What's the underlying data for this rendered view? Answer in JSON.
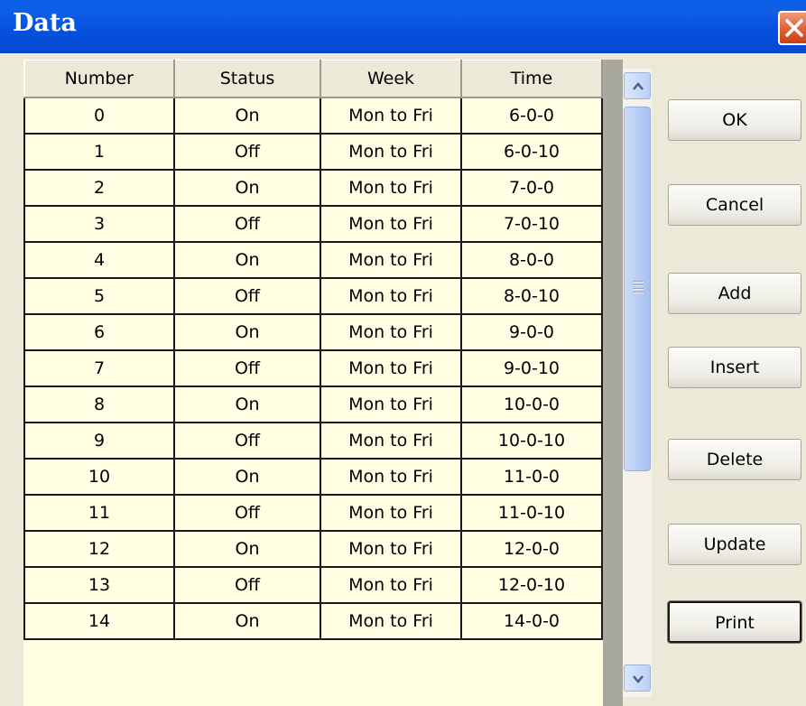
{
  "window": {
    "title": "Data"
  },
  "table": {
    "columns": [
      "Number",
      "Status",
      "Week",
      "Time"
    ],
    "rows": [
      [
        "0",
        "On",
        "Mon to Fri",
        "6-0-0"
      ],
      [
        "1",
        "Off",
        "Mon to Fri",
        "6-0-10"
      ],
      [
        "2",
        "On",
        "Mon to Fri",
        "7-0-0"
      ],
      [
        "3",
        "Off",
        "Mon to Fri",
        "7-0-10"
      ],
      [
        "4",
        "On",
        "Mon to Fri",
        "8-0-0"
      ],
      [
        "5",
        "Off",
        "Mon to Fri",
        "8-0-10"
      ],
      [
        "6",
        "On",
        "Mon to Fri",
        "9-0-0"
      ],
      [
        "7",
        "Off",
        "Mon to Fri",
        "9-0-10"
      ],
      [
        "8",
        "On",
        "Mon to Fri",
        "10-0-0"
      ],
      [
        "9",
        "Off",
        "Mon to Fri",
        "10-0-10"
      ],
      [
        "10",
        "On",
        "Mon to Fri",
        "11-0-0"
      ],
      [
        "11",
        "Off",
        "Mon to Fri",
        "11-0-10"
      ],
      [
        "12",
        "On",
        "Mon to Fri",
        "12-0-0"
      ],
      [
        "13",
        "Off",
        "Mon to Fri",
        "12-0-10"
      ],
      [
        "14",
        "On",
        "Mon to Fri",
        "14-0-0"
      ]
    ]
  },
  "buttons": {
    "ok": "OK",
    "cancel": "Cancel",
    "add": "Add",
    "insert": "Insert",
    "delete": "Delete",
    "update": "Update",
    "print": "Print"
  },
  "icons": {
    "close": "close-icon",
    "scroll_up": "chevron-up-icon",
    "scroll_down": "chevron-down-icon",
    "grip": "grip-icon"
  },
  "colors": {
    "titlebar": "#0550dc",
    "cell_background": "#ffffe4",
    "dialog_background": "#ece9d8"
  }
}
